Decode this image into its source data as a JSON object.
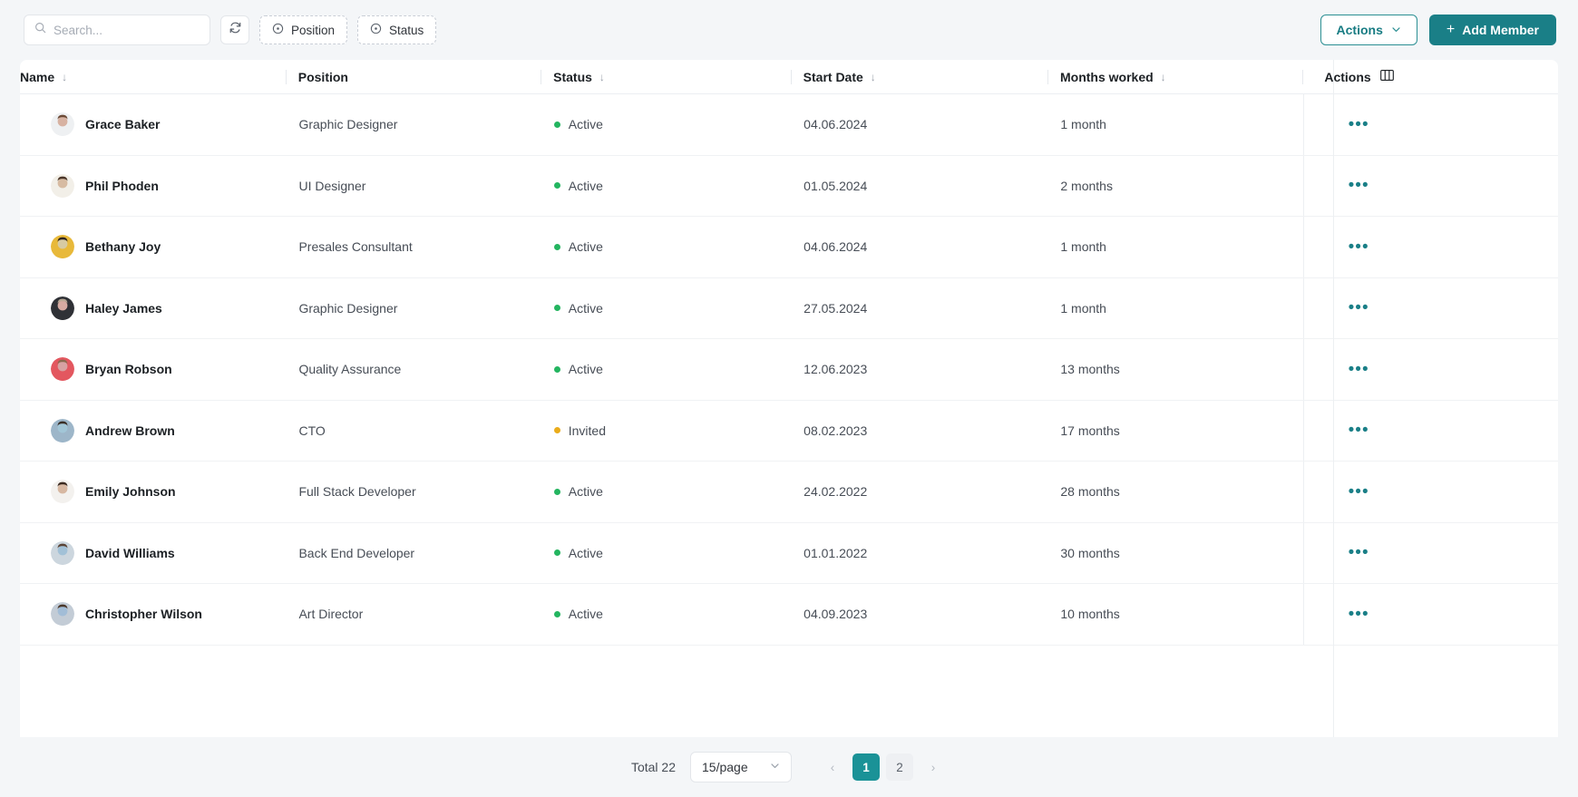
{
  "accent": {
    "teal": "#1a7f87",
    "teal_active": "#1a9297",
    "green": "#24b560",
    "amber": "#eaac1b"
  },
  "toolbar": {
    "search_placeholder": "Search...",
    "search_value": "",
    "refresh_label": "refresh",
    "filters": [
      {
        "label": "Position"
      },
      {
        "label": "Status"
      }
    ],
    "actions_label": "Actions",
    "add_member_label": "Add Member",
    "add_member_plus": "+"
  },
  "table": {
    "columns": [
      {
        "key": "name",
        "label": "Name",
        "sortable": true
      },
      {
        "key": "position",
        "label": "Position",
        "sortable": false
      },
      {
        "key": "status",
        "label": "Status",
        "sortable": true
      },
      {
        "key": "date",
        "label": "Start Date",
        "sortable": true
      },
      {
        "key": "months",
        "label": "Months worked",
        "sortable": true
      },
      {
        "key": "actions",
        "label": "Actions",
        "sortable": false
      }
    ],
    "sort_glyph": "↓",
    "row_action_glyph": "•••",
    "rows": [
      {
        "name": "Grace Baker",
        "position": "Graphic Designer",
        "status": "Active",
        "status_kind": "active",
        "date": "04.06.2024",
        "months": "1 month",
        "avatar_hue": 18,
        "avatar_shirt": "#eef0f2",
        "avatar_hair": "#6b4a36"
      },
      {
        "name": "Phil Phoden",
        "position": "UI Designer",
        "status": "Active",
        "status_kind": "active",
        "date": "01.05.2024",
        "months": "2 months",
        "avatar_hue": 28,
        "avatar_shirt": "#f2efe8",
        "avatar_hair": "#4a3527"
      },
      {
        "name": "Bethany Joy",
        "position": "Presales Consultant",
        "status": "Active",
        "status_kind": "active",
        "date": "04.06.2024",
        "months": "1 month",
        "avatar_hue": 45,
        "avatar_shirt": "#e8b93a",
        "avatar_hair": "#2f2520"
      },
      {
        "name": "Haley James",
        "position": "Graphic Designer",
        "status": "Active",
        "status_kind": "active",
        "date": "27.05.2024",
        "months": "1 month",
        "avatar_hue": 10,
        "avatar_shirt": "#2f3136",
        "avatar_hair": "#b9a894"
      },
      {
        "name": "Bryan Robson",
        "position": "Quality Assurance",
        "status": "Active",
        "status_kind": "active",
        "date": "12.06.2023",
        "months": "13 months",
        "avatar_hue": 0,
        "avatar_shirt": "#e3575f",
        "avatar_hair": "#8c6a4e"
      },
      {
        "name": "Andrew Brown",
        "position": "CTO",
        "status": "Invited",
        "status_kind": "invited",
        "date": "08.02.2023",
        "months": "17 months",
        "avatar_hue": 200,
        "avatar_shirt": "#9db6c9",
        "avatar_hair": "#3a2e26"
      },
      {
        "name": "Emily Johnson",
        "position": "Full Stack Developer",
        "status": "Active",
        "status_kind": "active",
        "date": "24.02.2022",
        "months": "28 months",
        "avatar_hue": 25,
        "avatar_shirt": "#f3f1ee",
        "avatar_hair": "#3b2a20"
      },
      {
        "name": "David Williams",
        "position": "Back End Developer",
        "status": "Active",
        "status_kind": "active",
        "date": "01.01.2022",
        "months": "30 months",
        "avatar_hue": 205,
        "avatar_shirt": "#ccd6de",
        "avatar_hair": "#5b4436"
      },
      {
        "name": "Christopher Wilson",
        "position": "Art Director",
        "status": "Active",
        "status_kind": "active",
        "date": "04.09.2023",
        "months": "10 months",
        "avatar_hue": 210,
        "avatar_shirt": "#c3ccd6",
        "avatar_hair": "#4b382b"
      }
    ]
  },
  "footer": {
    "total_label": "Total 22",
    "page_size_label": "15/page",
    "prev_glyph": "‹",
    "next_glyph": "›",
    "pages": [
      "1",
      "2"
    ],
    "current_page": "1"
  }
}
